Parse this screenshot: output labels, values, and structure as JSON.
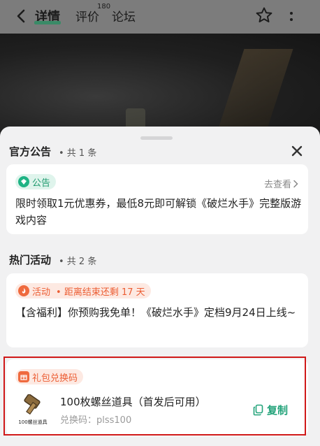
{
  "header": {
    "tabs": [
      {
        "label": "详情"
      },
      {
        "label": "评价"
      },
      {
        "label": "论坛"
      }
    ],
    "review_count": "180"
  },
  "notice": {
    "title": "官方公告",
    "count": "• 共 1 条",
    "badge": "公告",
    "view_more": "去查看",
    "content": "限时领取1元优惠券，最低8元即可解锁《破烂水手》完整版游戏内容"
  },
  "activity": {
    "title": "热门活动",
    "count": "• 共 2 条",
    "badge": "活动",
    "badge_extra": "•  距离结束还剩 17 天",
    "content": "【含福利】你预购我免单！《破烂水手》定档9月24日上线~"
  },
  "gift": {
    "badge": "礼包兑换码",
    "name": "100枚螺丝道具（首发后可用）",
    "code": "兑换码：plss100",
    "copy_label": "复制",
    "image_caption": "100螺丝道具"
  },
  "colors": {
    "accent_green": "#23a37a",
    "accent_orange": "#ec5e34",
    "highlight_red": "#d01818"
  },
  "icons": [
    "back-icon",
    "star-icon",
    "more-icon",
    "close-icon",
    "notice-icon",
    "activity-icon",
    "gift-icon",
    "copy-icon",
    "chevron-right-icon"
  ]
}
